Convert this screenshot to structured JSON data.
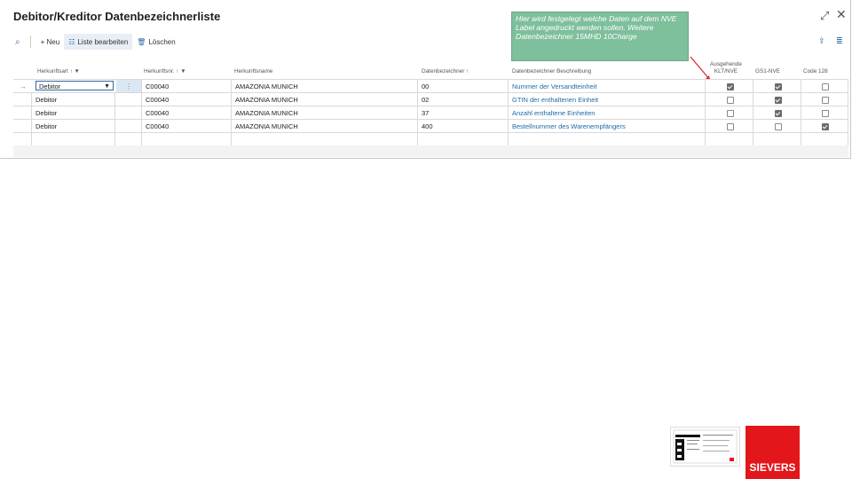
{
  "page": {
    "title": "Debitor/Kreditor Datenbezeichnerliste",
    "expand_icon": "expand-icon",
    "close_icon": "close-icon"
  },
  "toolbar": {
    "search_icon": "search-icon",
    "new_label": "+ Neu",
    "edit_list_label": "Liste bearbeiten",
    "delete_label": "Löschen",
    "share_icon": "share-icon",
    "list_view_icon": "list-view-icon"
  },
  "note": {
    "text": "Hier wird festgelegt welche Daten auf dem NVE Label angedruckt werden sollen. Weitere Datenbezeichner 15MHD 10Charge"
  },
  "columns": {
    "herkunftsart": "Herkunftsart ↑ ▼",
    "herkunftsnr": "Herkunftsnr. ↑ ▼",
    "herkunftsname": "Herkunftsname",
    "datenbezeichner": "Datenbezeichner ↑",
    "beschreibung": "Datenbezeichner Beschreibung",
    "klt_line1": "Ausgehende",
    "klt_line2": "KLT/NVE",
    "gs1": "GS1-NVE",
    "code128": "Code 128"
  },
  "rows": [
    {
      "art": "Debitor",
      "nr": "C00040",
      "name": "AMAZONIA MUNICH",
      "db": "00",
      "desc": "Nummer der Versandteinheit",
      "klt": true,
      "gs1": true,
      "code128": false
    },
    {
      "art": "Debitor",
      "nr": "C00040",
      "name": "AMAZONIA MUNICH",
      "db": "02",
      "desc": "GTIN der enthaltenen Einheit",
      "klt": false,
      "gs1": true,
      "code128": false
    },
    {
      "art": "Debitor",
      "nr": "C00040",
      "name": "AMAZONIA MUNICH",
      "db": "37",
      "desc": "Anzahl enthaltene Einheiten",
      "klt": false,
      "gs1": true,
      "code128": false
    },
    {
      "art": "Debitor",
      "nr": "C00040",
      "name": "AMAZONIA MUNICH",
      "db": "400",
      "desc": "Bestellnummer des Warenempfängers",
      "klt": false,
      "gs1": false,
      "code128": true
    }
  ],
  "row_marker": "→",
  "row_menu": "⋮",
  "logo": {
    "text": "SIEVERS",
    "color": "#e3161b"
  },
  "colors": {
    "accent": "#2d6aa5",
    "note_bg": "#7ebf9c",
    "arrow": "#e0202a"
  }
}
